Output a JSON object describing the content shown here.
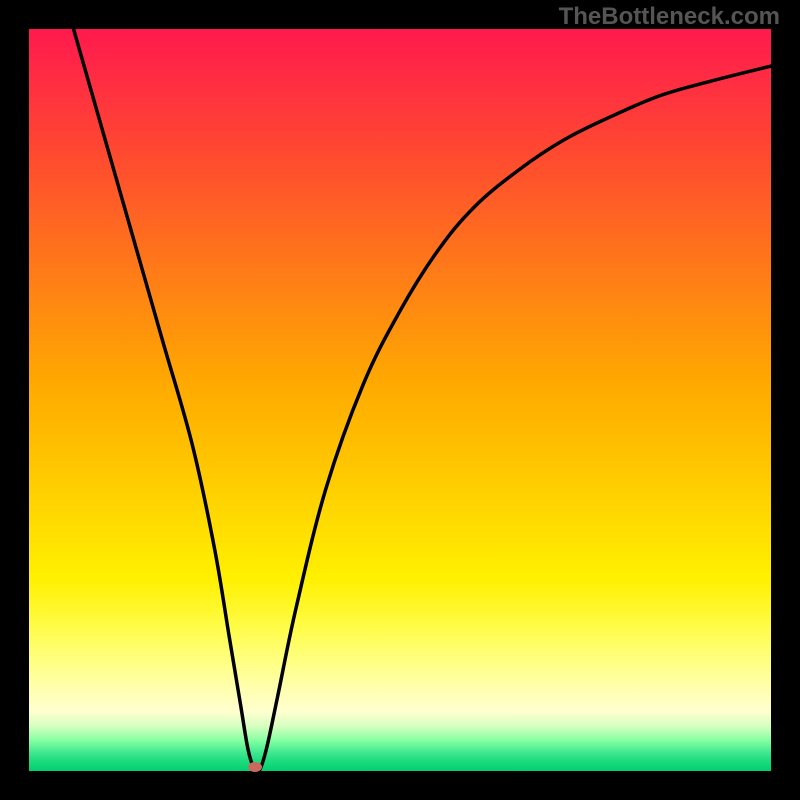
{
  "watermark": "TheBottleneck.com",
  "chart_data": {
    "type": "line",
    "title": "",
    "xlabel": "",
    "ylabel": "",
    "xlim": [
      0,
      100
    ],
    "ylim": [
      0,
      100
    ],
    "series": [
      {
        "name": "curve",
        "x": [
          6,
          10,
          14,
          18,
          22,
          25,
          27,
          28.5,
          29.5,
          30.3,
          31,
          32,
          33.5,
          36,
          40,
          45,
          50,
          55,
          60,
          66,
          72,
          78,
          85,
          92,
          100
        ],
        "values": [
          100,
          86,
          72,
          58,
          44,
          30,
          18,
          9,
          3,
          0.5,
          0,
          3,
          10,
          22,
          38,
          52,
          62,
          70,
          76,
          81,
          85,
          88,
          91,
          93,
          95
        ]
      }
    ],
    "marker": {
      "x": 30.5,
      "y": 0.5
    },
    "gradient_colors": {
      "top": "#ff1a4d",
      "middle": "#ffdd00",
      "bottom": "#00d070"
    }
  }
}
